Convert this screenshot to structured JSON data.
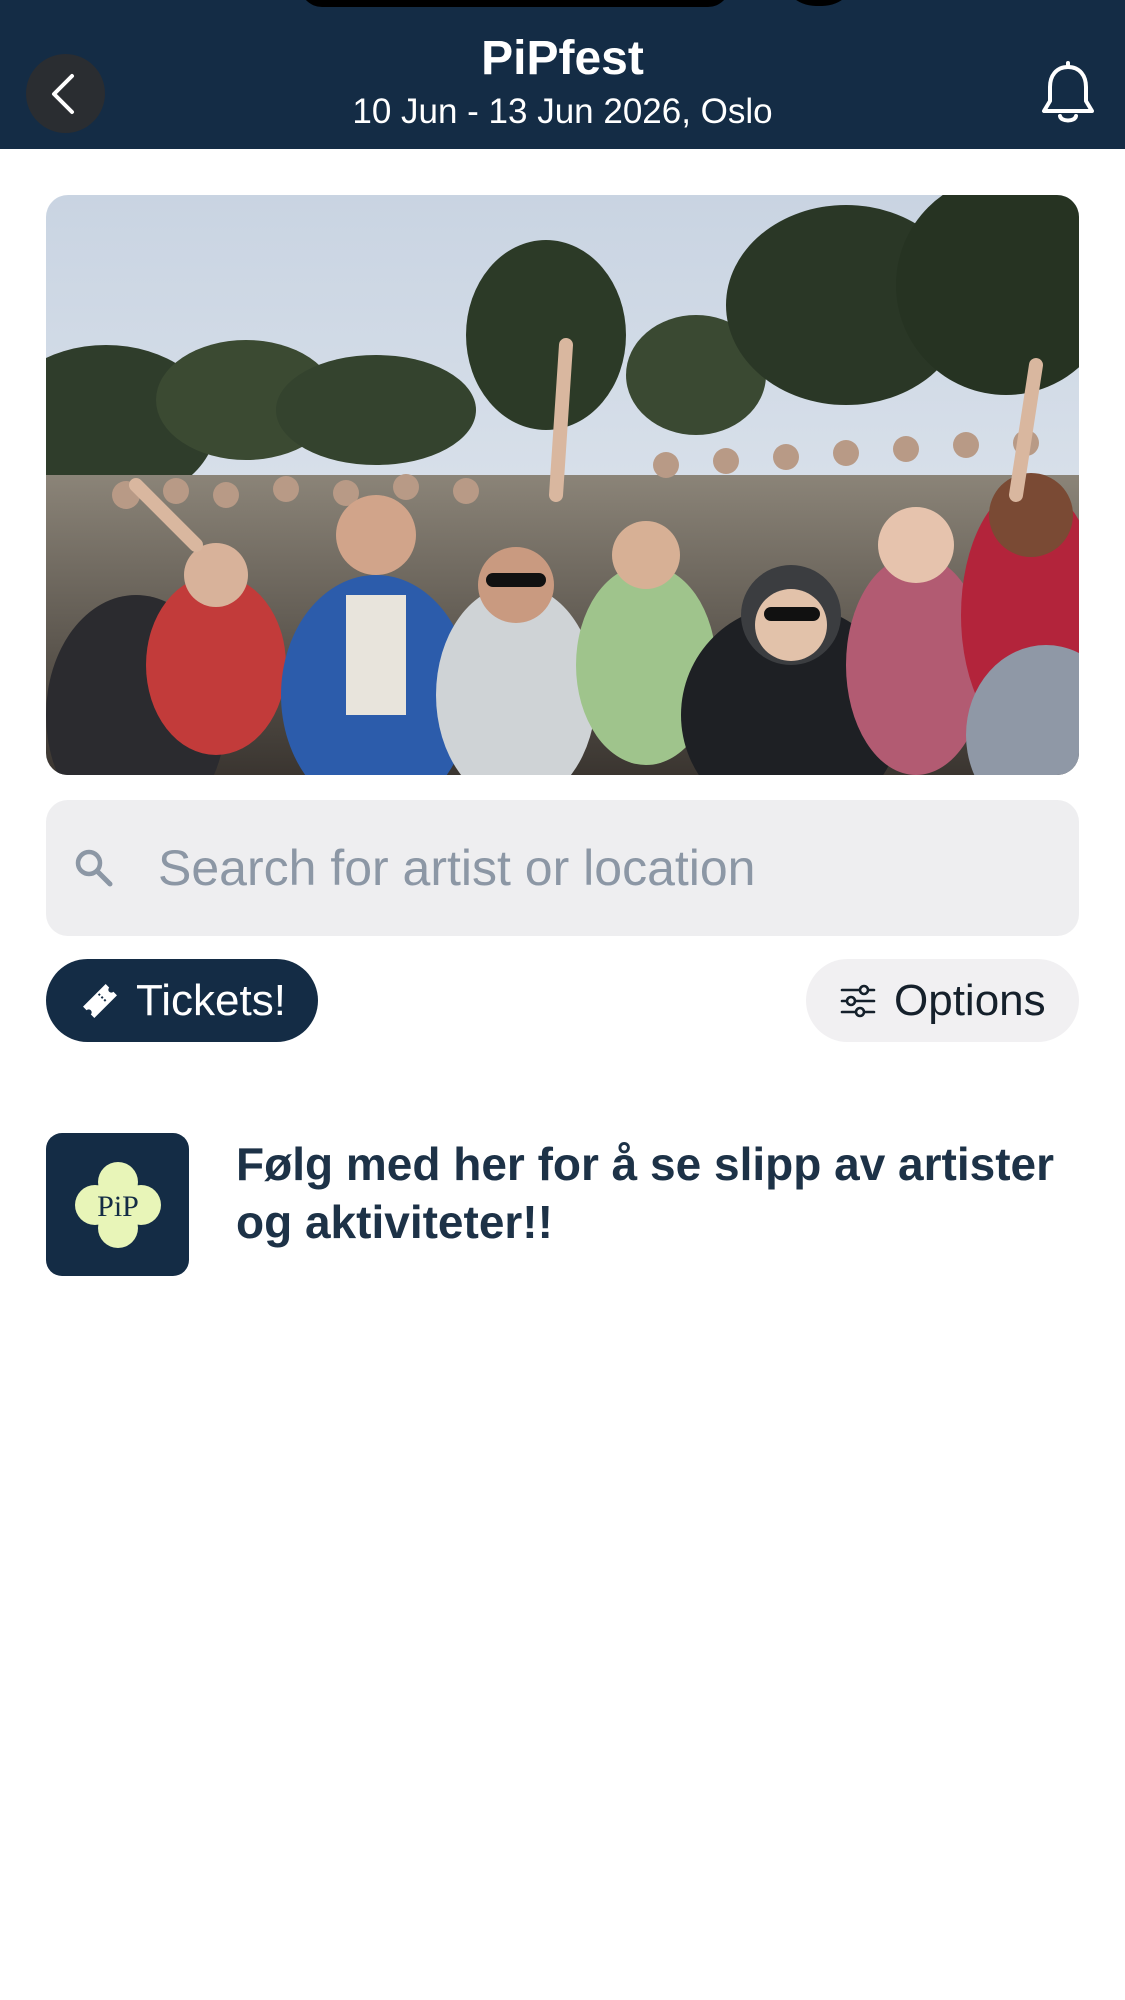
{
  "header": {
    "title": "PiPfest",
    "subtitle": "10 Jun - 13 Jun 2026, Oslo",
    "back_icon": "chevron-left-icon",
    "notification_icon": "bell-icon",
    "background_color": "#142c45"
  },
  "hero": {
    "description_icon": "festival-crowd-photo"
  },
  "search": {
    "placeholder": "Search for artist or location",
    "value": "",
    "icon": "search-icon"
  },
  "actions": {
    "tickets_label": "Tickets!",
    "tickets_icon": "ticket-icon",
    "options_label": "Options",
    "options_icon": "sliders-icon"
  },
  "feed": {
    "items": [
      {
        "logo_text": "PiP",
        "text": "Følg med her for å se slipp av artister og aktiviteter!!"
      }
    ]
  },
  "colors": {
    "brand": "#142c45",
    "logo_flower": "#e8f5b8",
    "search_bg": "#eeeef0",
    "options_bg": "#f1f0f2"
  }
}
